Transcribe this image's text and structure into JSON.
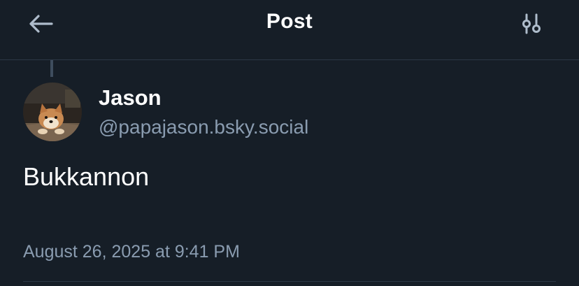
{
  "header": {
    "title": "Post",
    "back_icon": "arrow-left-icon",
    "filter_icon": "sliders-icon"
  },
  "post": {
    "author": {
      "display_name": "Jason",
      "handle": "@papajason.bsky.social",
      "avatar_icon": "dog-avatar"
    },
    "text": "Bukkannon",
    "timestamp": "August 26, 2025 at 9:41 PM"
  },
  "colors": {
    "background": "#161e27",
    "divider": "#2c3846",
    "thread_line": "#3e4d5e",
    "primary_text": "#ffffff",
    "secondary_text": "#8a9cb0",
    "icon": "#aebccb"
  }
}
